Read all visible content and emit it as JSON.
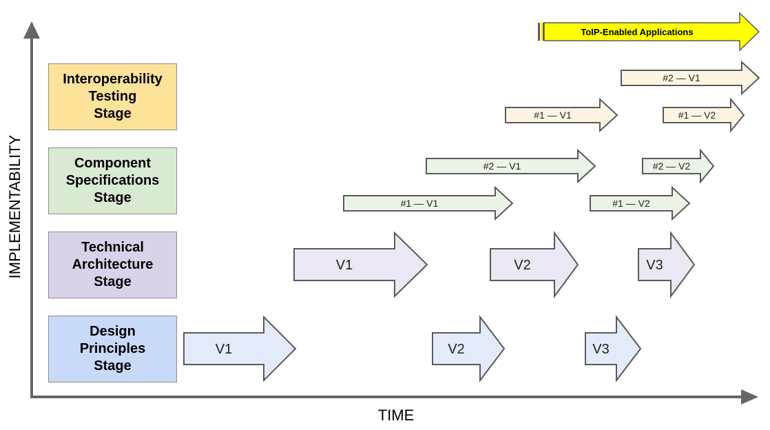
{
  "axes": {
    "y_label": "IMPLEMENTABILITY",
    "x_label": "TIME"
  },
  "colors": {
    "axis": "#666666",
    "outline": "#595959",
    "interop_stage_fill": "#fde29a",
    "interop_arrow_fill": "#fdf5e3",
    "component_stage_fill": "#d9ead3",
    "component_arrow_fill": "#e9f3e6",
    "architecture_stage_fill": "#d9d2e9",
    "architecture_arrow_fill": "#ebe8f4",
    "design_stage_fill": "#c9daf8",
    "design_arrow_fill": "#e3ebfb",
    "tip_arrow_fill": "#ffff00"
  },
  "stages": [
    {
      "id": "interop",
      "label": "Interoperability\nTesting\nStage"
    },
    {
      "id": "component",
      "label": "Component\nSpecifications\nStage"
    },
    {
      "id": "architecture",
      "label": "Technical\nArchitecture\nStage"
    },
    {
      "id": "design",
      "label": "Design\nPrinciples\nStage"
    }
  ],
  "banner": {
    "label": "ToIP-Enabled Applications"
  },
  "arrows": {
    "interop": [
      {
        "label": "#1 — V1"
      },
      {
        "label": "#2 — V1"
      },
      {
        "label": "#1 — V2"
      }
    ],
    "component": [
      {
        "label": "#1 — V1"
      },
      {
        "label": "#2 — V1"
      },
      {
        "label": "#1 — V2"
      },
      {
        "label": "#2 — V2"
      }
    ],
    "architecture": [
      {
        "label": "V1"
      },
      {
        "label": "V2"
      },
      {
        "label": "V3"
      }
    ],
    "design": [
      {
        "label": "V1"
      },
      {
        "label": "V2"
      },
      {
        "label": "V3"
      }
    ]
  }
}
